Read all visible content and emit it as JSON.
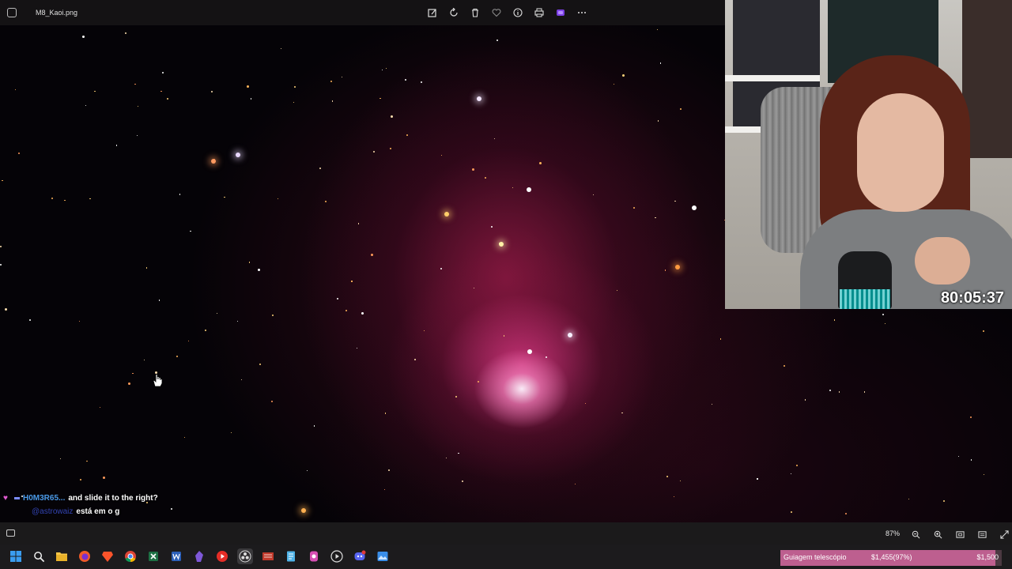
{
  "window": {
    "filename": "M8_Kaoi.png"
  },
  "toolbar": {
    "items": [
      {
        "name": "edit-image-icon"
      },
      {
        "name": "rotate-icon"
      },
      {
        "name": "delete-icon"
      },
      {
        "name": "favorite-icon"
      },
      {
        "name": "info-icon"
      },
      {
        "name": "print-icon"
      },
      {
        "name": "clipchamp-icon"
      },
      {
        "name": "more-icon"
      }
    ]
  },
  "webcam": {
    "timer": "80:05:37"
  },
  "chat": {
    "lines": [
      {
        "user": "H0M3R65...",
        "message": "and slide it to the right?"
      },
      {
        "user": "@astrowaiz",
        "message": "está em o g"
      }
    ]
  },
  "statusbar": {
    "zoom": "87%"
  },
  "goal": {
    "label": "Guiagem telescópio",
    "progress": "$1,455(97%)",
    "target": "$1,500",
    "fraction": 0.97
  },
  "colors": {
    "accent": "#bd5f8f",
    "nebula": "#c02a6a",
    "username": "#4a9ae8"
  }
}
